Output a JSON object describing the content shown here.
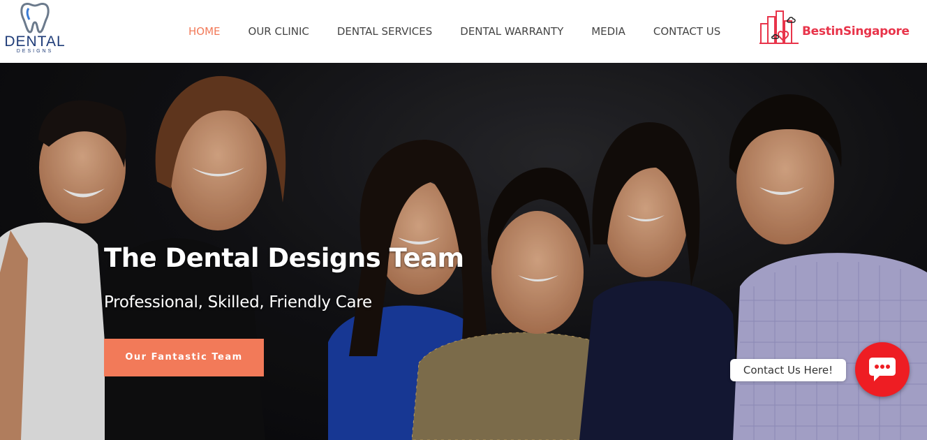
{
  "brand": {
    "logo_word": "DENTAL",
    "logo_sub": "DESIGNS",
    "logo_color": "#1f3c78"
  },
  "nav": {
    "items": [
      {
        "label": "HOME",
        "active": true
      },
      {
        "label": "OUR CLINIC",
        "active": false
      },
      {
        "label": "DENTAL SERVICES",
        "active": false
      },
      {
        "label": "DENTAL WARRANTY",
        "active": false
      },
      {
        "label": "MEDIA",
        "active": false
      },
      {
        "label": "CONTACT US",
        "active": false
      }
    ],
    "active_color": "#f27a59"
  },
  "partner_badge": {
    "text": "BestinSingapore",
    "color": "#e8344a",
    "icon": "city-skyline-icon"
  },
  "hero": {
    "title": "The Dental Designs Team",
    "subtitle": "Professional, Skilled, Friendly Care",
    "cta_label": "Our Fantastic Team",
    "cta_color": "#f27a59",
    "image": "team-photo"
  },
  "chat_widget": {
    "label": "Contact Us Here!",
    "icon": "chat-bubble-icon",
    "color": "#ee1d23"
  }
}
